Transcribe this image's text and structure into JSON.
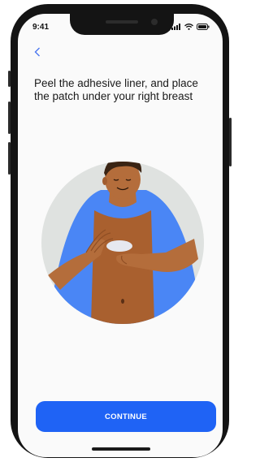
{
  "status_bar": {
    "time": "9:41",
    "icons": [
      "signal-icon",
      "wifi-icon",
      "battery-icon"
    ]
  },
  "nav": {
    "back_icon": "chevron-left-icon"
  },
  "instruction": {
    "title": "Peel the adhesive liner, and place the patch under your right breast"
  },
  "footer": {
    "continue_label": "CONTINUE"
  },
  "colors": {
    "accent": "#1f63f5",
    "back_link": "#4a76f0",
    "shirt": "#4a86f5",
    "skin": "#b46d3b",
    "circle_bg": "#dfe2e0"
  }
}
